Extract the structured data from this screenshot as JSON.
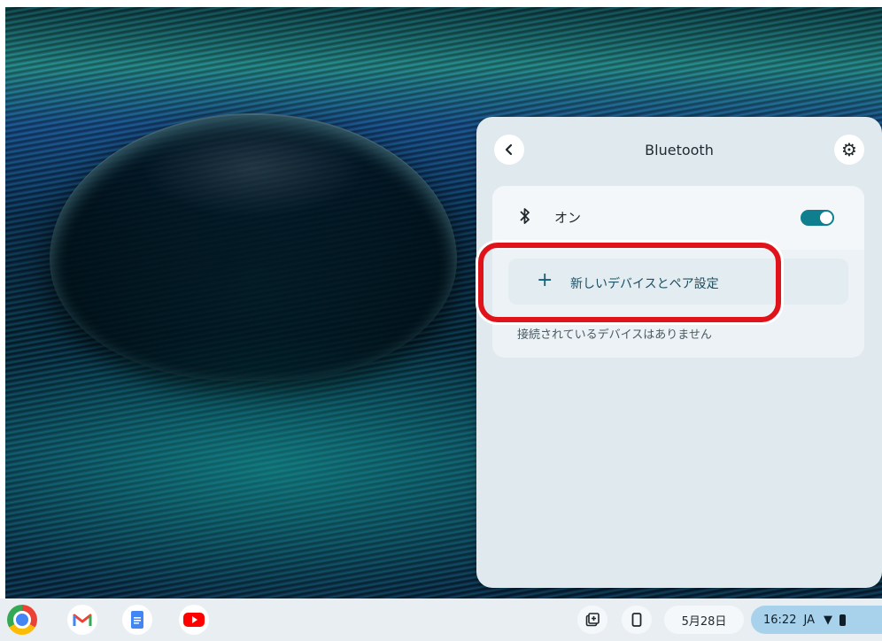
{
  "bluetooth_panel": {
    "title": "Bluetooth",
    "back_icon": "chevron-left-icon",
    "settings_icon": "gear-icon",
    "toggle_label": "オン",
    "toggle_on": true,
    "pair_label": "新しいデバイスとペア設定",
    "no_devices_text": "接続されているデバイスはありません"
  },
  "shelf": {
    "apps": [
      "Chrome",
      "Gmail",
      "Docs",
      "YouTube"
    ],
    "date": "5月28日",
    "time": "16:22",
    "ime": "JA"
  },
  "colors": {
    "highlight": "#e0121a",
    "toggle_on": "#0f7f8f",
    "status_bg": "#a8d2ec"
  }
}
